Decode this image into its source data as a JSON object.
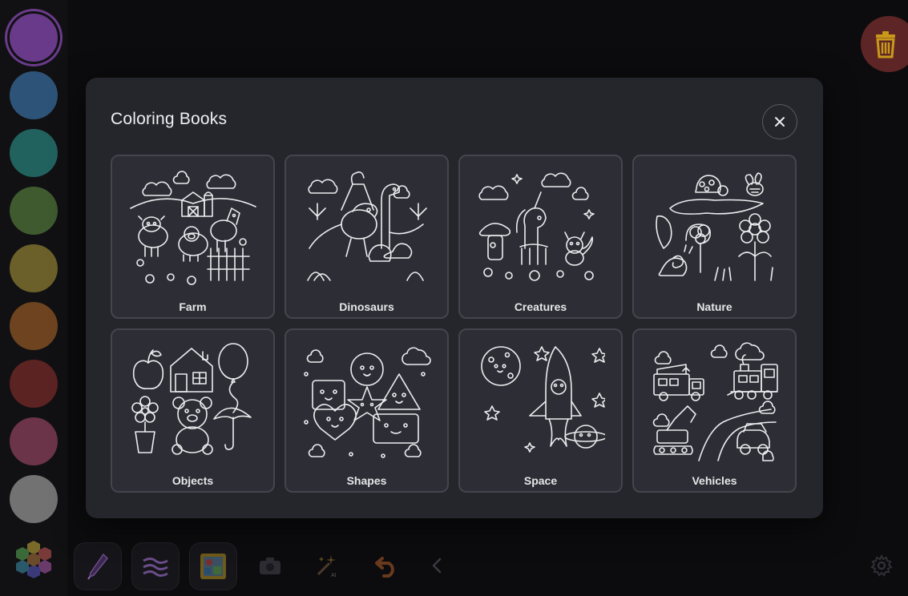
{
  "palette": {
    "colors": [
      "#6a3a8a",
      "#2d5478",
      "#22625e",
      "#3f5a2f",
      "#6b5f2a",
      "#6e4420",
      "#5c2323",
      "#6b3449",
      "#727272"
    ],
    "selected": 0
  },
  "trash": {
    "icon": "trash-icon",
    "color": "#d3a21b"
  },
  "toolbar": {
    "items": [
      "pen-icon",
      "waves-icon",
      "image-gallery-icon",
      "camera-icon",
      "magic-wand-ai-icon",
      "undo-icon",
      "chevron-left-icon"
    ],
    "settings_icon": "gear-icon",
    "ai_badge": "AI"
  },
  "modal": {
    "title": "Coloring Books",
    "close_icon": "close-icon",
    "books": [
      {
        "label": "Farm"
      },
      {
        "label": "Dinosaurs"
      },
      {
        "label": "Creatures"
      },
      {
        "label": "Nature"
      },
      {
        "label": "Objects"
      },
      {
        "label": "Shapes"
      },
      {
        "label": "Space"
      },
      {
        "label": "Vehicles"
      }
    ]
  }
}
